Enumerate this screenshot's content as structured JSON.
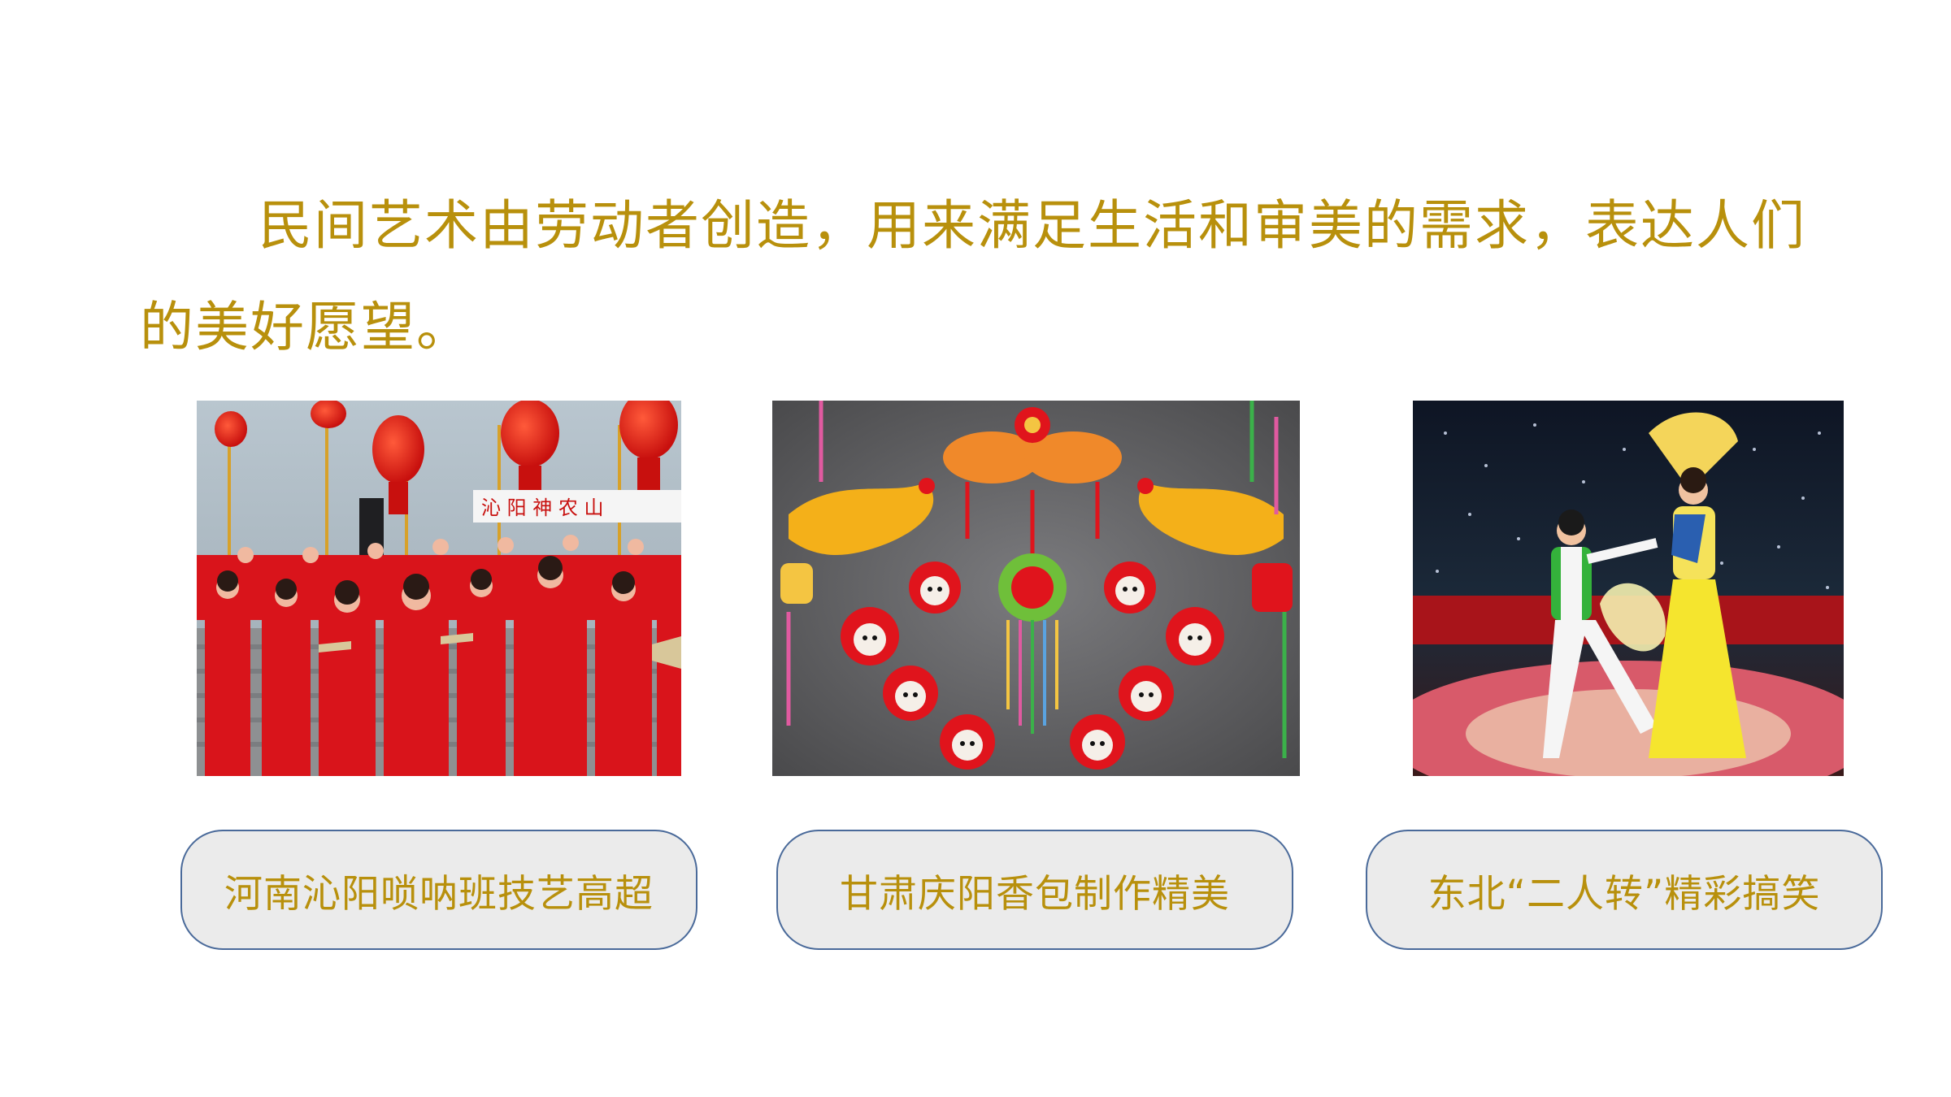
{
  "intro": {
    "text": "民间艺术由劳动者创造，用来满足生活和审美的需求，表达人们的美好愿望。"
  },
  "photos": [
    {
      "subject": "suona band performers in red costumes with red lanterns",
      "sign_text": "沁 阳 神 农 山"
    },
    {
      "subject": "colorful embroidered sachets with dragons, fish and tassels"
    },
    {
      "subject": "two-person Errenzhuan dance performers on a stage"
    }
  ],
  "captions": [
    {
      "label": "河南沁阳唢呐班技艺高超"
    },
    {
      "label": "甘肃庆阳香包制作精美"
    },
    {
      "label": "东北“二人转”精彩搞笑"
    }
  ],
  "colors": {
    "text_gold": "#b8900c",
    "caption_bg": "#ebebeb",
    "caption_border": "#4a6a9a",
    "festive_red": "#e0141c"
  }
}
